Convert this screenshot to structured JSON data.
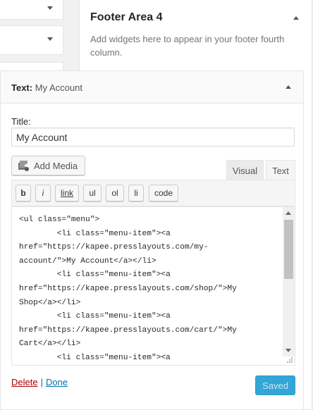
{
  "footer_area": {
    "title": "Footer Area 4",
    "description": "Add widgets here to appear in your footer fourth column."
  },
  "widget": {
    "type_label": "Text:",
    "name": "My Account",
    "title_label": "Title:",
    "title_value": "My Account",
    "add_media_label": "Add Media",
    "tab_visual": "Visual",
    "tab_text": "Text",
    "quicktags": [
      "b",
      "i",
      "link",
      "ul",
      "ol",
      "li",
      "code"
    ],
    "content": "<ul class=\"menu\">\n        <li class=\"menu-item\"><a\nhref=\"https://kapee.presslayouts.com/my-\naccount/\">My Account</a></li>\n        <li class=\"menu-item\"><a\nhref=\"https://kapee.presslayouts.com/shop/\">My\nShop</a></li>\n        <li class=\"menu-item\"><a\nhref=\"https://kapee.presslayouts.com/cart/\">My\nCart</a></li>\n        <li class=\"menu-item\"><a",
    "delete_label": "Delete",
    "separator": "|",
    "done_label": "Done",
    "saved_label": "Saved"
  },
  "colors": {
    "accent": "#0073aa",
    "delete": "#aa0000",
    "saved_button": "#33a5d6"
  }
}
